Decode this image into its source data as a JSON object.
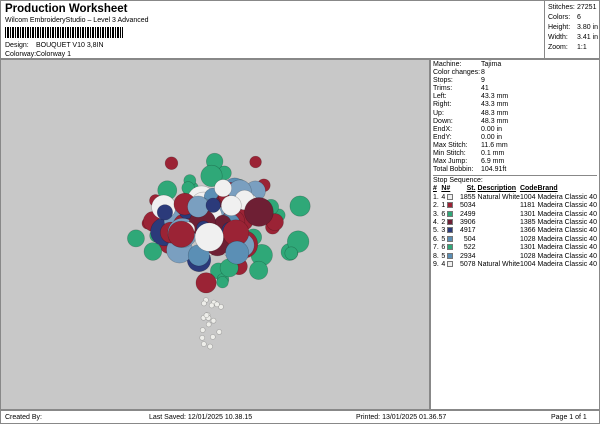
{
  "header": {
    "title": "Production Worksheet",
    "subtitle": "Wilcom EmbroideryStudio – Level 3 Advanced",
    "design_label": "Design:",
    "design": "BOUQUET V10 3,8IN",
    "colorway_label": "Colorway:",
    "colorway": "Colorway 1"
  },
  "stats": [
    {
      "k": "Stitches:",
      "v": "27251"
    },
    {
      "k": "Colors:",
      "v": "6"
    },
    {
      "k": "Height:",
      "v": "3.80 in"
    },
    {
      "k": "Width:",
      "v": "3.41 in"
    },
    {
      "k": "Zoom:",
      "v": "1:1"
    }
  ],
  "info": [
    {
      "k": "Machine:",
      "v": "Tajima"
    },
    {
      "k": "Color changes:",
      "v": "8"
    },
    {
      "k": "Stops:",
      "v": "9"
    },
    {
      "k": "Trims:",
      "v": "41"
    },
    {
      "k": "Left:",
      "v": "43.3 mm"
    },
    {
      "k": "Right:",
      "v": "43.3 mm"
    },
    {
      "k": "Up:",
      "v": "48.3 mm"
    },
    {
      "k": "Down:",
      "v": "48.3 mm"
    },
    {
      "k": "EndX:",
      "v": "0.00 in"
    },
    {
      "k": "EndY:",
      "v": "0.00 in"
    },
    {
      "k": "Max Stitch:",
      "v": "11.6 mm"
    },
    {
      "k": "Min Stitch:",
      "v": "0.1 mm"
    },
    {
      "k": "Max Jump:",
      "v": "6.9 mm"
    },
    {
      "k": "Total Bobbin:",
      "v": "104.91ft"
    }
  ],
  "stop_sequence": {
    "title": "Stop Sequence:",
    "headers": [
      "#",
      "N#",
      "St.",
      "Description",
      "Code",
      "Brand"
    ],
    "rows": [
      {
        "n": "1.",
        "c": "4",
        "color": "#f0f0f0",
        "st": "1855",
        "desc": "Natural White",
        "code": "1004",
        "brand": "Madeira Classic 40"
      },
      {
        "n": "2.",
        "c": "1",
        "color": "#9b2335",
        "st": "5034",
        "desc": "",
        "code": "1181",
        "brand": "Madeira Classic 40"
      },
      {
        "n": "3.",
        "c": "6",
        "color": "#2fa878",
        "st": "2499",
        "desc": "",
        "code": "1301",
        "brand": "Madeira Classic 40"
      },
      {
        "n": "4.",
        "c": "2",
        "color": "#6e1f34",
        "st": "3906",
        "desc": "",
        "code": "1385",
        "brand": "Madeira Classic 40"
      },
      {
        "n": "5.",
        "c": "3",
        "color": "#2b3a7a",
        "st": "4917",
        "desc": "",
        "code": "1366",
        "brand": "Madeira Classic 40"
      },
      {
        "n": "6.",
        "c": "5",
        "color": "#5b8fb5",
        "st": "504",
        "desc": "",
        "code": "1028",
        "brand": "Madeira Classic 40"
      },
      {
        "n": "7.",
        "c": "6",
        "color": "#2fa878",
        "st": "522",
        "desc": "",
        "code": "1301",
        "brand": "Madeira Classic 40"
      },
      {
        "n": "8.",
        "c": "5",
        "color": "#5b8fb5",
        "st": "2934",
        "desc": "",
        "code": "1028",
        "brand": "Madeira Classic 40"
      },
      {
        "n": "9.",
        "c": "4",
        "color": "#f0f0f0",
        "st": "5078",
        "desc": "Natural White",
        "code": "1004",
        "brand": "Madeira Classic 40"
      }
    ]
  },
  "footer": {
    "created": "Created By:",
    "saved": "Last Saved: 12/01/2025 10.38.15",
    "printed": "Printed: 13/01/2025 01.36.57",
    "page": "Page 1 of 1"
  }
}
